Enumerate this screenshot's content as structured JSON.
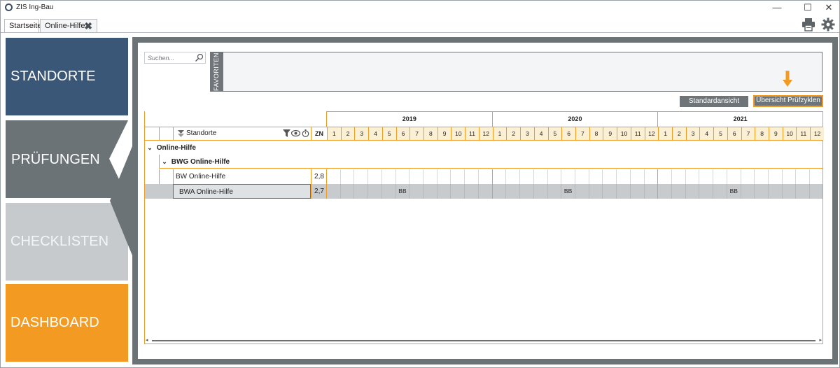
{
  "window": {
    "title": "ZIS Ing-Bau",
    "minimize": "—",
    "maximize": "☐",
    "close": "✕"
  },
  "tabs": [
    {
      "label": "Startseite",
      "active": true
    },
    {
      "label": "Online-Hilfe",
      "active": false,
      "close": "✖"
    }
  ],
  "toolbar": {
    "print_icon": "printer-icon",
    "settings_icon": "gear-icon"
  },
  "nav": {
    "standorte": "STANDORTE",
    "pruefungen": "PRÜFUNGEN",
    "checklisten": "CHECKLISTEN",
    "dashboard": "DASHBOARD"
  },
  "colors": {
    "accent": "#f39a22",
    "nav_dark": "#3b5778",
    "nav_gray": "#6b7377",
    "nav_light": "#c6cacd",
    "selected_row": "#c8cbcd"
  },
  "search": {
    "placeholder": "Suchen..."
  },
  "favorites": {
    "label": "FAVORITEN"
  },
  "views": {
    "standard": "Standardansicht",
    "overview": "Übersicht Prüfzyklen"
  },
  "table": {
    "col_standorte": "Standorte",
    "col_zn": "ZN",
    "years": [
      "2019",
      "2020",
      "2021"
    ],
    "months": [
      "1",
      "2",
      "3",
      "4",
      "5",
      "6",
      "7",
      "8",
      "9",
      "10",
      "11",
      "12"
    ],
    "group1": "Online-Hilfe",
    "group2": "BWG Online-Hilfe",
    "rows": [
      {
        "name": "BW Online-Hilfe",
        "zn": "2,8",
        "marks": {}
      },
      {
        "name": "BWA Online-Hilfe",
        "zn": "2,7",
        "marks": {
          "2019-6": "BB",
          "2020-6": "BB",
          "2021-6": "BB"
        }
      }
    ]
  }
}
